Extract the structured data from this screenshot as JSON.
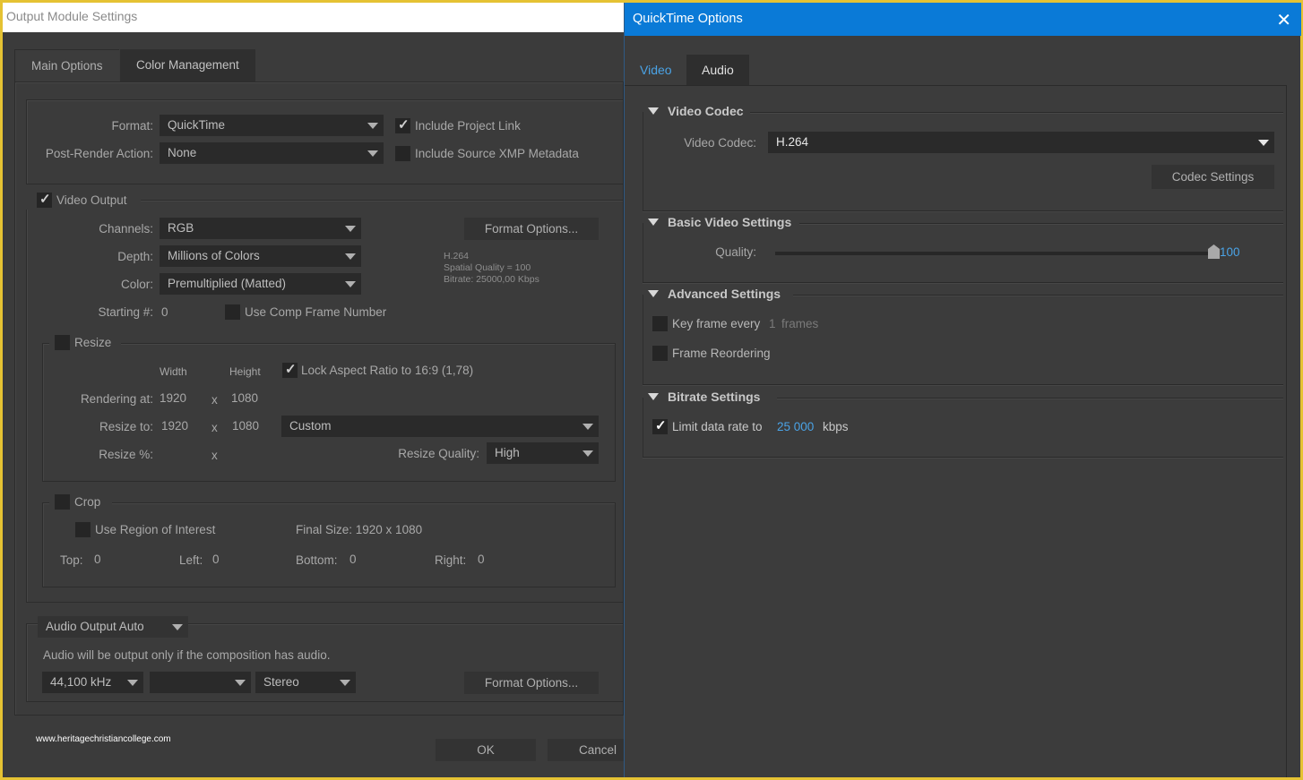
{
  "left_dialog": {
    "title": "Output Module Settings",
    "tabs": [
      {
        "label": "Main Options",
        "active": true
      },
      {
        "label": "Color Management",
        "active": false
      }
    ],
    "format": {
      "label": "Format:",
      "value": "QuickTime"
    },
    "post_render": {
      "label": "Post-Render Action:",
      "value": "None"
    },
    "include_project_link": {
      "label": "Include Project Link",
      "checked": true
    },
    "include_xmp": {
      "label": "Include Source XMP Metadata",
      "checked": false
    },
    "video_output": {
      "label": "Video Output",
      "checked": true,
      "channels": {
        "label": "Channels:",
        "value": "RGB"
      },
      "depth": {
        "label": "Depth:",
        "value": "Millions of Colors"
      },
      "color": {
        "label": "Color:",
        "value": "Premultiplied (Matted)"
      },
      "starting": {
        "label": "Starting #:",
        "value": "0"
      },
      "use_comp_frame": {
        "label": "Use Comp Frame Number",
        "checked": false
      },
      "format_options_label": "Format Options...",
      "summary": [
        "H.264",
        "Spatial Quality = 100",
        "Bitrate: 25000,00 Kbps"
      ]
    },
    "resize": {
      "label": "Resize",
      "checked": false,
      "width_header": "Width",
      "height_header": "Height",
      "lock_aspect": {
        "label": "Lock Aspect Ratio to 16:9 (1,78)",
        "checked": true
      },
      "rendering_at": {
        "label": "Rendering at:",
        "width": "1920",
        "height": "1080"
      },
      "resize_to": {
        "label": "Resize to:",
        "width": "1920",
        "height": "1080",
        "preset": "Custom"
      },
      "resize_pct": {
        "label": "Resize %:"
      },
      "x": "x",
      "quality": {
        "label": "Resize Quality:",
        "value": "High"
      }
    },
    "crop": {
      "label": "Crop",
      "checked": false,
      "use_roi": {
        "label": "Use Region of Interest",
        "checked": false
      },
      "final_size": "Final Size: 1920 x 1080",
      "top": {
        "label": "Top:",
        "value": "0"
      },
      "left": {
        "label": "Left:",
        "value": "0"
      },
      "bottom": {
        "label": "Bottom:",
        "value": "0"
      },
      "right": {
        "label": "Right:",
        "value": "0"
      }
    },
    "audio": {
      "mode": "Audio Output Auto",
      "note": "Audio will be output only if the composition has audio.",
      "rate": "44,100 kHz",
      "depth": "",
      "channels": "Stereo",
      "format_options_label": "Format Options..."
    },
    "watermark": "www.heritagechristiancollege.com",
    "ok_label": "OK",
    "cancel_label": "Cancel"
  },
  "right_dialog": {
    "title": "QuickTime Options",
    "tabs": [
      {
        "label": "Video",
        "active": true
      },
      {
        "label": "Audio",
        "active": false
      }
    ],
    "video_codec": {
      "section": "Video Codec",
      "label": "Video Codec:",
      "value": "H.264",
      "codec_settings_label": "Codec Settings"
    },
    "basic_video": {
      "section": "Basic Video Settings",
      "quality_label": "Quality:",
      "quality_value": "100",
      "quality_fraction": 1.0
    },
    "advanced": {
      "section": "Advanced Settings",
      "key_frame": {
        "label": "Key frame every",
        "value": "1",
        "unit": "frames",
        "checked": false
      },
      "frame_reordering": {
        "label": "Frame Reordering",
        "checked": false
      }
    },
    "bitrate": {
      "section": "Bitrate Settings",
      "limit": {
        "label": "Limit data rate to",
        "value": "25 000",
        "unit": "kbps",
        "checked": true
      }
    }
  },
  "colors": {
    "title_bar_blue": "#0a7ad7",
    "accent_blue": "#4aa3e6",
    "frame_yellow": "#e5c233",
    "bg_dark": "#3b3b3b"
  }
}
